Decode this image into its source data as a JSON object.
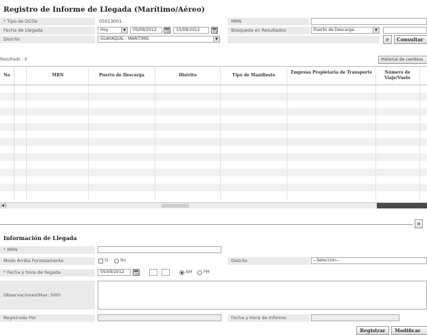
{
  "page_title": "Registro de Informe de Llegada (Marítimo/Aéreo)",
  "search": {
    "tipo_ocd_label": "Tipo de OCDs",
    "tipo_ocd_value": "05013001",
    "mrn_label": "MRN",
    "fecha_label": "Fecha de Llegada",
    "fecha_preset": "Hoy",
    "fecha_desde": "05/09/2012",
    "fecha_hasta": "15/09/2012",
    "busqueda_label": "Búsqueda en Resultados",
    "busqueda_value": "Puerto de Descarga",
    "distrito_label": "Distrito",
    "distrito_value": "GUAYAQUIL - MARITIMO",
    "consult_button": "Consultar"
  },
  "results": {
    "count_label": "Resultado : 0",
    "historial_button": "Historial de cambios",
    "columns": [
      "No",
      "MRN",
      "Puerto de Descarga",
      "Distrito",
      "Tipo de Manifiesto",
      "Empresa Propietaria de Transporte",
      "Número de Viaje/Vuelo"
    ]
  },
  "info": {
    "section_title": "Información de Llegada",
    "mrn_label": "MRN",
    "modo_label": "Modo Arriba Forzosamente",
    "si_label": "SI",
    "no_label": "No",
    "distrito_label": "Distrito",
    "distrito_value": "--Seleccion--",
    "fecha_label": "Fecha y hora de llegada",
    "fecha_value": "05/09/2012",
    "am_label": "AM",
    "pm_label": "PM",
    "time_separator": ":",
    "obs_label": "Observaciones(Max: 500)",
    "registrado_label": "Registrado Por",
    "fecha_informe_label": "Fecha y Hora de Informe"
  },
  "actions": {
    "registrar": "Registrar",
    "modificar": "Modificar"
  }
}
